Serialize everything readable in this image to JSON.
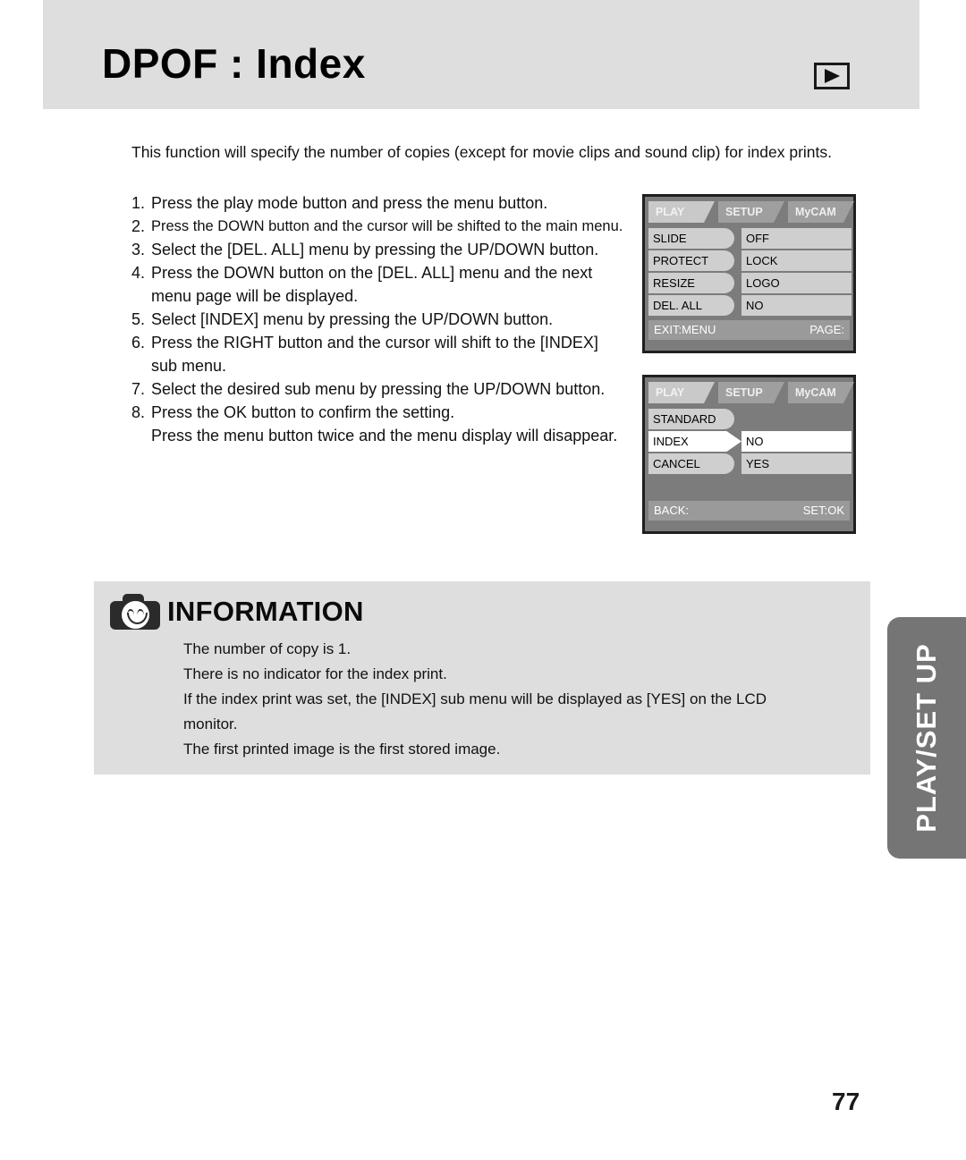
{
  "header": {
    "title": "DPOF : Index",
    "mode_icon": "play-triangle-icon"
  },
  "intro": "This function will specify the number of copies (except for movie clips and sound clip) for index prints.",
  "steps": [
    {
      "num": "1.",
      "text": "Press the play mode button and press the menu button."
    },
    {
      "num": "2.",
      "text": "Press the DOWN button and the cursor will be shifted to the main menu."
    },
    {
      "num": "3.",
      "text": "Select the [DEL. ALL] menu by pressing the UP/DOWN button."
    },
    {
      "num": "4.",
      "text": "Press the DOWN button on the [DEL. ALL] menu and the next",
      "cont": "menu page will be displayed."
    },
    {
      "num": "5.",
      "text": "Select [INDEX] menu by pressing the UP/DOWN button."
    },
    {
      "num": "6.",
      "text": "Press the RIGHT button and the cursor will shift to the [INDEX]",
      "cont": "sub menu."
    },
    {
      "num": "7.",
      "text": "Select the desired sub menu by pressing the UP/DOWN button."
    },
    {
      "num": "8.",
      "text": "Press the OK button to confirm the setting.",
      "cont": "Press the menu button twice and the menu display will disappear."
    }
  ],
  "lcd_screens": [
    {
      "id": "screen-1",
      "tabs": [
        {
          "label": "PLAY",
          "active": true
        },
        {
          "label": "SETUP",
          "active": false
        },
        {
          "label": "MyCAM",
          "active": false
        }
      ],
      "rows": [
        {
          "left": "SLIDE",
          "right": "OFF",
          "left_selected": false,
          "right_selected": false
        },
        {
          "left": "PROTECT",
          "right": "LOCK",
          "left_selected": false,
          "right_selected": false
        },
        {
          "left": "RESIZE",
          "right": "LOGO",
          "left_selected": false,
          "right_selected": false
        },
        {
          "left": "DEL. ALL",
          "right": "NO",
          "left_selected": false,
          "right_selected": false
        }
      ],
      "status_left": "EXIT:MENU",
      "status_right": "PAGE:"
    },
    {
      "id": "screen-2",
      "tabs": [
        {
          "label": "PLAY",
          "active": true
        },
        {
          "label": "SETUP",
          "active": false
        },
        {
          "label": "MyCAM",
          "active": false
        }
      ],
      "rows": [
        {
          "left": "STANDARD",
          "right": "",
          "left_selected": false,
          "right_selected": false
        },
        {
          "left": "INDEX",
          "right": "NO",
          "left_selected": true,
          "right_selected": true
        },
        {
          "left": "CANCEL",
          "right": "YES",
          "left_selected": false,
          "right_selected": false
        }
      ],
      "status_left": "BACK:",
      "status_right": "SET:OK"
    }
  ],
  "information": {
    "icon": "camera-smiley-icon",
    "title": "INFORMATION",
    "lines": [
      "The number of copy is 1.",
      "There is no indicator for the index print.",
      "If the index print was set, the [INDEX] sub menu will be displayed as [YES] on the LCD",
      "monitor.",
      "The first printed image is the first stored image."
    ]
  },
  "side_tab": {
    "label": "PLAY/SET UP"
  },
  "page_number": "77",
  "colors": {
    "band_gray": "#dedede",
    "lcd_bg": "#7c7c7c",
    "lcd_item": "#cfcfcf",
    "lcd_selected": "#ffffff",
    "side_tab": "#757575"
  }
}
